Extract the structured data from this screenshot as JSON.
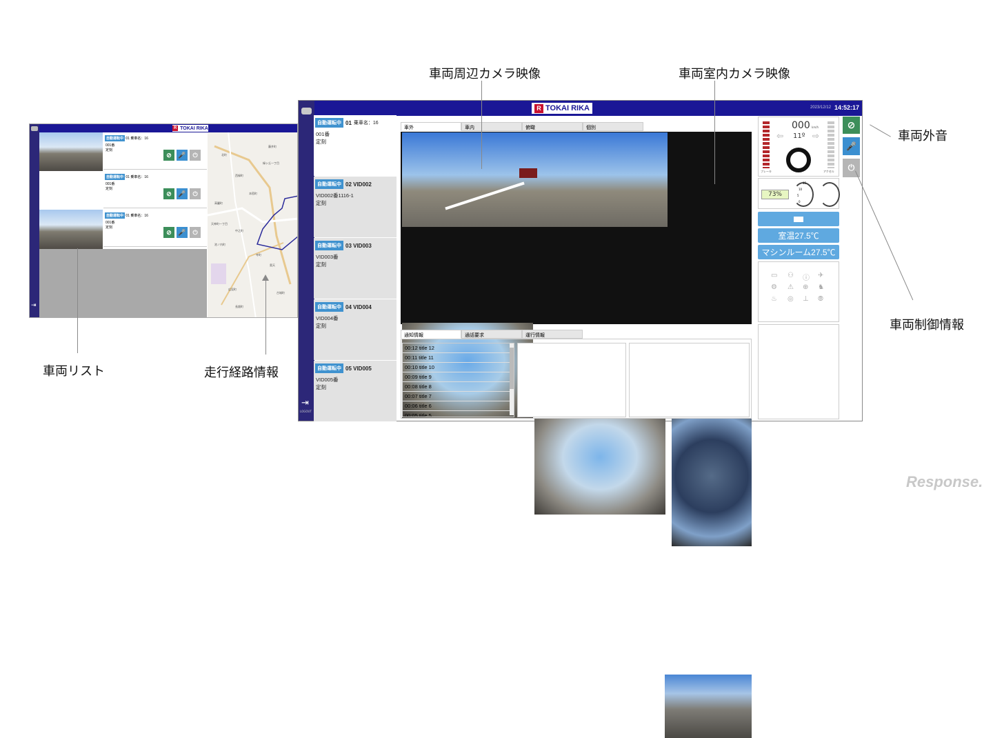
{
  "callouts": {
    "surround_camera": "車両周辺カメラ映像",
    "interior_camera": "車両室内カメラ映像",
    "exterior_sound": "車両外音",
    "vehicle_control": "車両制御情報",
    "vehicle_list": "車両リスト",
    "route_info": "走行経路情報"
  },
  "brand": {
    "logo": "TOKAI RIKA",
    "mark": "R"
  },
  "watermark": "Response.",
  "small_screen": {
    "cards": [
      {
        "badge": "自動運転中",
        "vid": "01 乗車名：16",
        "l1": "001番",
        "l2": "定刻"
      },
      {
        "badge": "自動運転中",
        "vid": "01 乗車名：16",
        "l1": "001番",
        "l2": "定刻"
      },
      {
        "badge": "自動運転中",
        "vid": "01 乗車名：16",
        "l1": "001番",
        "l2": "定刻"
      }
    ],
    "map_labels": [
      "藤井町",
      "緑ヶ丘一丁目",
      "西緑町",
      "本宿町",
      "高麗町",
      "天神町一丁目",
      "中之町",
      "寺町",
      "池ノ内町",
      "奥天",
      "広見町",
      "長畑町",
      "北町",
      "古城町"
    ]
  },
  "big_screen": {
    "datetime": "2023/12/12",
    "time": "14:52:17",
    "vehicles": [
      {
        "badge": "自動運転中",
        "vid": "01",
        "extra": "乗車名：16",
        "l1": "001番",
        "l2": "定刻"
      },
      {
        "badge": "自動運転中",
        "vid": "02 VID002",
        "extra": "",
        "l1": "VID002番1116-1",
        "l2": "定刻"
      },
      {
        "badge": "自動運転中",
        "vid": "03 VID003",
        "extra": "",
        "l1": "VID003番",
        "l2": "定刻"
      },
      {
        "badge": "自動運転中",
        "vid": "04 VID004",
        "extra": "",
        "l1": "VID004番",
        "l2": "定刻"
      },
      {
        "badge": "自動運転中",
        "vid": "05 VID005",
        "extra": "",
        "l1": "VID005番",
        "l2": "定刻"
      }
    ],
    "camera_tabs": [
      "車外",
      "車内",
      "俯瞰",
      "個別"
    ],
    "info_tabs": [
      "通知情報",
      "通話要求",
      "運行情報"
    ],
    "notifications": [
      "00:12 title 12",
      "00:11 title 11",
      "00:10 title 10",
      "00:09 title 9",
      "00:08 title 8",
      "00:07 title 7",
      "00:06 title 6",
      "00:05 title 5"
    ],
    "speed": "000",
    "speed_unit": "km/h",
    "steer_angle": "11º",
    "brake_label": "ブレーキ",
    "accel_label": "アクセル",
    "battery": "73%",
    "room_temp": "室温27.5℃",
    "machine_temp": "マシンルーム27.5℃",
    "gauge_marks": [
      "15",
      "10",
      "5",
      "0"
    ],
    "control_buttons": [
      "NG",
      "マイク",
      "INVALID"
    ],
    "logout": "LOGOUT"
  },
  "colors": {
    "nav": "#1a1796",
    "side": "#2c2778",
    "badge": "#3f92cf",
    "green": "#3c8e5a",
    "blue": "#3b8fd0"
  }
}
